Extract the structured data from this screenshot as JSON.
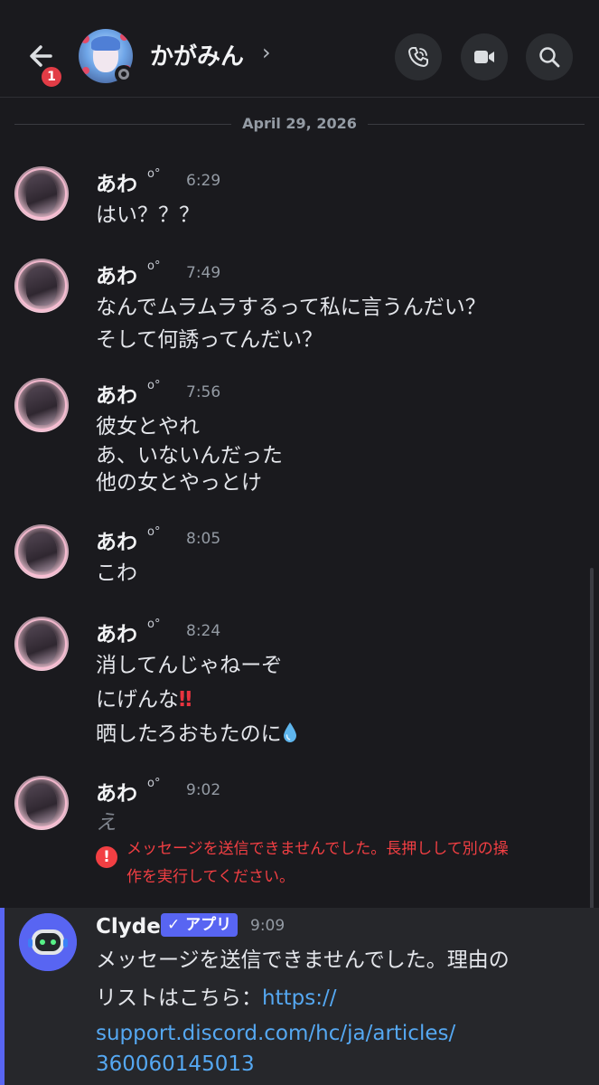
{
  "header": {
    "back_badge": "1",
    "title": "かがみん",
    "chevron": "›",
    "icons": [
      "arrow-left-icon",
      "phone-icon",
      "video-camera-icon",
      "search-icon"
    ]
  },
  "date_separator": "April 29, 2026",
  "messages": [
    {
      "author": "あわ",
      "bubbles": "o°",
      "time": "6:29",
      "lines": [
        "はい？？？"
      ]
    },
    {
      "author": "あわ",
      "bubbles": "o°",
      "time": "7:49",
      "lines": [
        "なんでムラムラするって私に言うんだい？",
        "そして何誘ってんだい？"
      ]
    },
    {
      "author": "あわ",
      "bubbles": "o°",
      "time": "7:56",
      "lines": [
        "彼女とやれ",
        "あ、いないんだった",
        "他の女とやっとけ"
      ]
    },
    {
      "author": "あわ",
      "bubbles": "o°",
      "time": "8:05",
      "lines": [
        "こわ"
      ]
    },
    {
      "author": "あわ",
      "bubbles": "o°",
      "time": "8:24",
      "lines": [
        "消してんじゃねーぞ",
        "にげんな",
        "晒したろおもたのに"
      ],
      "emoji": {
        "double_exclamation": "‼",
        "drop_icon": "droplet-emoji-icon"
      }
    },
    {
      "author": "あわ",
      "bubbles": "o°",
      "time": "9:02",
      "lines": [
        "え"
      ],
      "error": {
        "icon": "!",
        "lines": [
          "メッセージを送信できませんでした。長押しして別の操",
          "作を実行してください。"
        ]
      }
    }
  ],
  "clyde": {
    "name": "Clyde",
    "badge": "✓ アプリ",
    "time": "9:09",
    "lines": [
      "メッセージを送信できませんでした。理由の",
      "リストはこちら："
    ],
    "link_parts": [
      "https://",
      "support.discord.com/hc/ja/articles/",
      "360060145013"
    ]
  },
  "colors": {
    "background": "#1a1a1e",
    "accent": "#5865f2",
    "error": "#f23f43",
    "link": "#55a8f2"
  }
}
